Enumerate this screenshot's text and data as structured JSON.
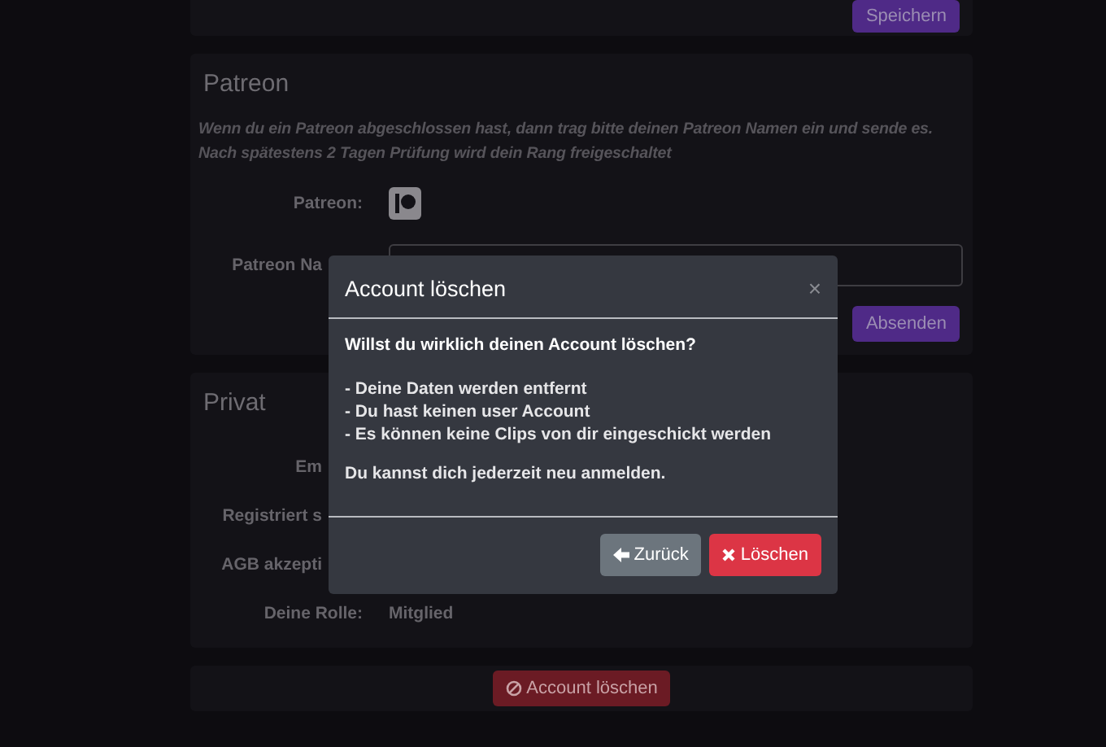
{
  "top_card": {
    "save_button": "Speichern"
  },
  "patreon": {
    "title": "Patreon",
    "description": "Wenn du ein Patreon abgeschlossen hast, dann trag bitte deinen Patreon Namen ein und sende es. Nach spätestens 2 Tagen Prüfung wird dein Rang freigeschaltet",
    "rows": [
      {
        "label": "Patreon:",
        "kind": "icon",
        "cut": false
      },
      {
        "label": "Patreon Na",
        "kind": "input",
        "cut": true
      }
    ],
    "submit_button": "Absenden"
  },
  "private": {
    "title": "Privat",
    "rows": [
      {
        "label": "Em",
        "cut": true
      },
      {
        "label": "Registriert s",
        "cut": true
      },
      {
        "label": "AGB akzepti",
        "cut": true
      },
      {
        "label": "Deine Rolle:",
        "cut": false,
        "value": "Mitglied"
      }
    ]
  },
  "delete_button": "Account löschen",
  "modal": {
    "title": "Account löschen",
    "close": "×",
    "question": "Willst du wirklich deinen Account löschen?",
    "points": [
      "- Deine Daten werden entfernt",
      "- Du hast keinen user Account",
      "- Es können keine Clips von dir eingeschickt werden"
    ],
    "note": "Du kannst dich jederzeit neu anmelden.",
    "buttons": [
      {
        "label": "Zurück",
        "kind": "back"
      },
      {
        "label": "Löschen",
        "kind": "delete"
      }
    ]
  }
}
